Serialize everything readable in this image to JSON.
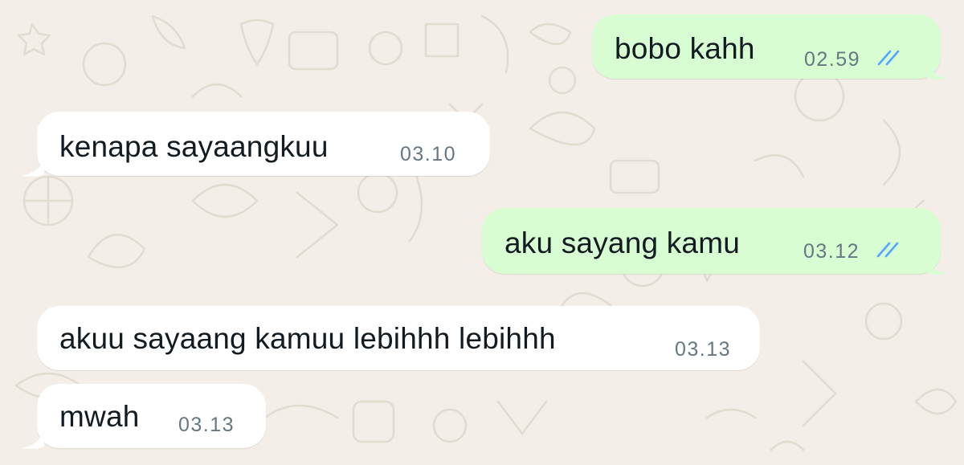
{
  "chat": {
    "background_color": "#f3efe8",
    "incoming_bubble_color": "#ffffff",
    "outgoing_bubble_color": "#d9fdd3",
    "read_tick_color": "#53a6fd",
    "messages": [
      {
        "direction": "outgoing",
        "text": "bobo kahh",
        "time": "02.59",
        "status": "read",
        "status_icon": "double-check-icon"
      },
      {
        "direction": "incoming",
        "text": "kenapa sayaangkuu",
        "time": "03.10"
      },
      {
        "direction": "outgoing",
        "text": "aku sayang kamu",
        "time": "03.12",
        "status": "read",
        "status_icon": "double-check-icon"
      },
      {
        "direction": "incoming",
        "text": "akuu sayaang kamuu lebihhh lebihhh",
        "time": "03.13"
      },
      {
        "direction": "incoming",
        "text": "mwah",
        "time": "03.13"
      }
    ]
  }
}
